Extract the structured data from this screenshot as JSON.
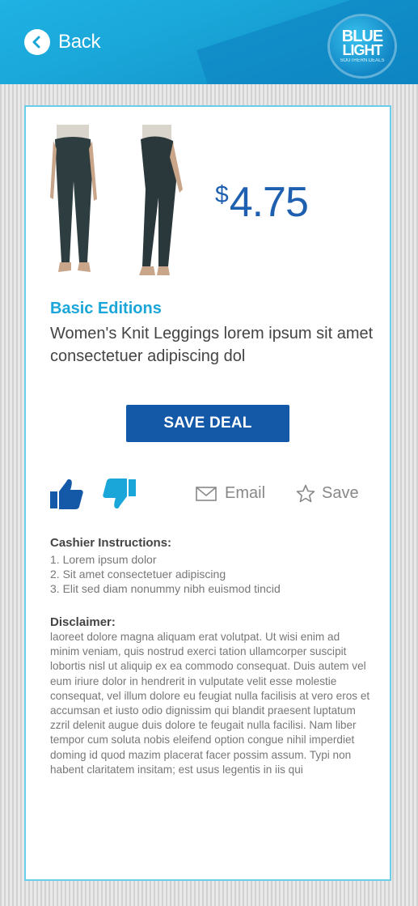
{
  "header": {
    "back_label": "Back",
    "logo": {
      "line1": "BLUE",
      "line2": "LIGHT",
      "line3": "SOUTHERN DEALS"
    }
  },
  "product": {
    "price_symbol": "$",
    "price_value": "4.75",
    "brand": "Basic Editions",
    "title": "Women's Knit Leggings lorem ipsum sit amet consectetuer adipiscing dol"
  },
  "actions": {
    "save_deal_label": "SAVE DEAL",
    "email_label": "Email",
    "save_label": "Save"
  },
  "cashier": {
    "heading": "Cashier Instructions:",
    "items": [
      "1. Lorem ipsum dolor",
      "2. Sit amet consectetuer adipiscing",
      "3. Elit sed diam nonummy nibh euismod tincid"
    ]
  },
  "disclaimer": {
    "heading": "Disclaimer:",
    "body": "laoreet dolore magna aliquam erat volutpat. Ut wisi enim ad minim veniam, quis nostrud exerci tation ullamcorper suscipit lobortis nisl ut aliquip ex ea commodo consequat. Duis autem vel eum iriure dolor in hendrerit in vulputate velit esse molestie consequat, vel illum dolore eu feugiat nulla facilisis at vero eros et accumsan et iusto odio dignissim qui blandit praesent luptatum zzril delenit augue duis dolore te feugait nulla facilisi. Nam liber tempor cum soluta nobis eleifend option congue nihil imperdiet doming id quod mazim placerat facer possim assum. Typi non habent claritatem insitam; est usus legentis in iis qui"
  },
  "icons": {
    "back": "back-arrow-icon",
    "thumbs_up": "thumbs-up-icon",
    "thumbs_down": "thumbs-down-icon",
    "email": "envelope-icon",
    "save": "star-icon"
  },
  "colors": {
    "header": "#1aa6d8",
    "brand": "#1aa6d8",
    "price": "#1f5fb0",
    "button": "#1458a8",
    "thumbs_up": "#1458a8",
    "thumbs_down": "#1aa6d8",
    "card_border": "#6ccde8"
  }
}
